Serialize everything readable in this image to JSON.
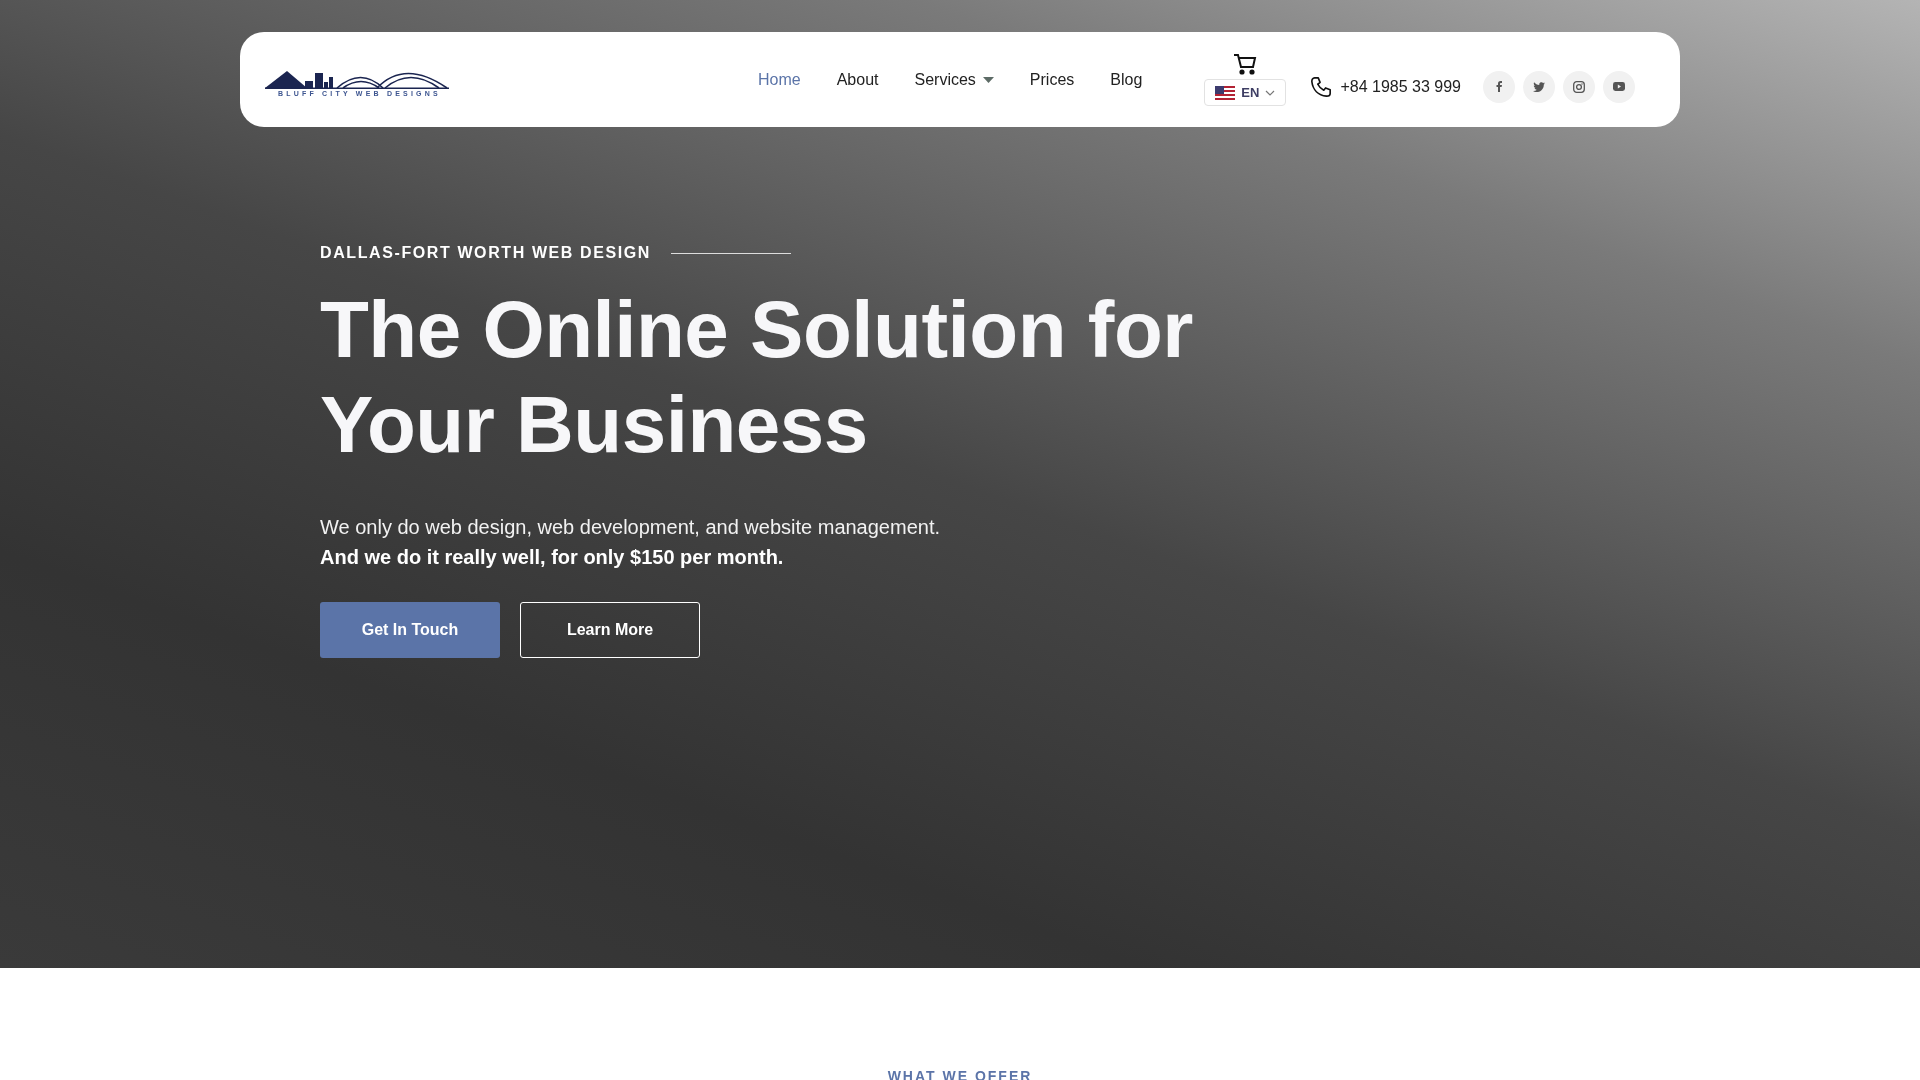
{
  "logo": {
    "tagline": "BLUFF CITY WEB DESIGNS"
  },
  "nav": [
    {
      "label": "Home",
      "selected": true,
      "kind": "link"
    },
    {
      "label": "About",
      "selected": false,
      "kind": "link"
    },
    {
      "label": "Services",
      "selected": false,
      "kind": "dropdown"
    },
    {
      "label": "Prices",
      "selected": false,
      "kind": "link"
    },
    {
      "label": "Blog",
      "selected": false,
      "kind": "link"
    }
  ],
  "language": {
    "code": "EN"
  },
  "phone": "+84 1985 33 999",
  "socials": [
    {
      "kind": "facebook"
    },
    {
      "kind": "twitter"
    },
    {
      "kind": "instagram"
    },
    {
      "kind": "youtube"
    }
  ],
  "hero": {
    "eyebrow": "DALLAS-FORT WORTH WEB DESIGN",
    "title_lines": [
      "The Online Solution for",
      "Your Business"
    ],
    "intro": "We only do web design, web development, and website management.",
    "emphasis": "And we do it really well, for only $150 per month.",
    "buttons": [
      {
        "label": "Get In Touch",
        "kind": "primary"
      },
      {
        "label": "Learn More",
        "kind": "outline"
      }
    ]
  },
  "next_section": {
    "eyebrow": "WHAT WE OFFER"
  }
}
